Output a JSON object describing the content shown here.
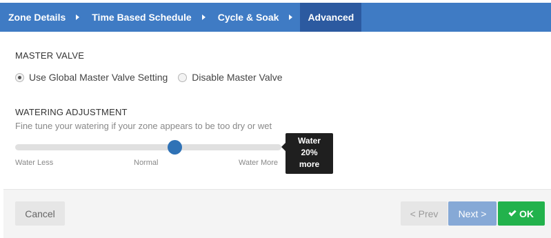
{
  "tabs": [
    {
      "label": "Zone Details"
    },
    {
      "label": "Time Based Schedule"
    },
    {
      "label": "Cycle & Soak"
    },
    {
      "label": "Advanced",
      "active": true
    }
  ],
  "master_valve": {
    "title": "MASTER VALVE",
    "options": [
      {
        "label": "Use Global Master Valve Setting",
        "checked": true
      },
      {
        "label": "Disable Master Valve",
        "checked": false
      }
    ]
  },
  "watering_adjustment": {
    "title": "WATERING ADJUSTMENT",
    "description": "Fine tune your watering if your zone appears to be too dry or wet",
    "slider_value_fraction": 0.6,
    "labels": {
      "less": "Water Less",
      "normal": "Normal",
      "more": "Water More"
    },
    "tooltip": {
      "line1": "Water",
      "line2": "20%",
      "line3": "more"
    }
  },
  "footer": {
    "cancel": "Cancel",
    "prev": "< Prev",
    "next": "Next >",
    "ok": "OK"
  },
  "colors": {
    "tabbar": "#3f7bc4",
    "tab_active": "#2c5aa0",
    "slider_handle": "#2f72b6",
    "ok_button": "#22b24c",
    "next_button": "#86a9d6"
  }
}
